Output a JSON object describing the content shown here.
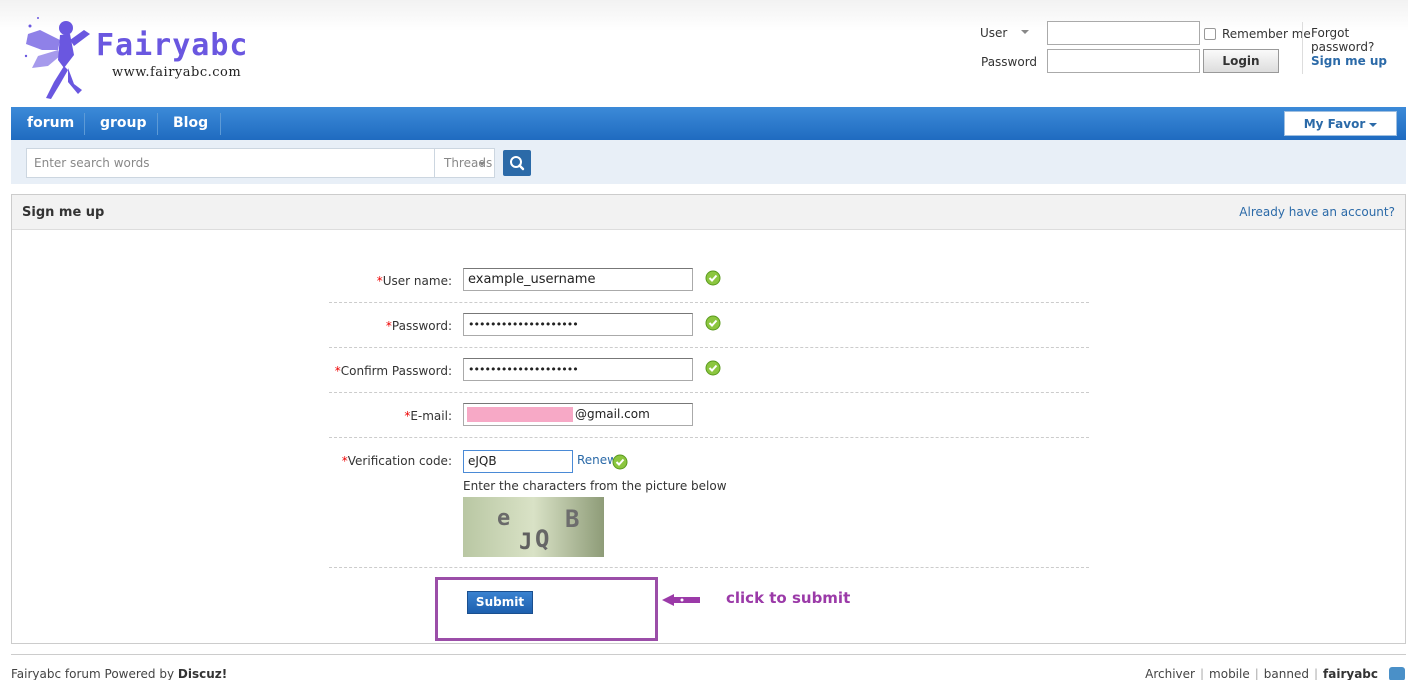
{
  "header": {
    "logo_title": "Fairyabc",
    "logo_url": "www.fairyabc.com",
    "user_label": "User",
    "password_label": "Password",
    "remember_label": "Remember me",
    "login_label": "Login",
    "forgot_label": "Forgot password?",
    "signup_label": "Sign me up"
  },
  "nav": {
    "items": [
      {
        "label": "forum"
      },
      {
        "label": "group"
      },
      {
        "label": "Blog"
      }
    ],
    "favor_label": "My Favor"
  },
  "search": {
    "placeholder": "Enter search words",
    "type_label": "Threads"
  },
  "panel": {
    "title": "Sign me up",
    "have_account": "Already have an account?"
  },
  "form": {
    "required_mark": "*",
    "username_label": "User name:",
    "username_value": "example_username",
    "password_label": "Password:",
    "password_value": "••••••••••••••••••••",
    "confirm_label": "Confirm Password:",
    "confirm_value": "••••••••••••••••••••",
    "email_label": "E-mail:",
    "email_value": "@gmail.com",
    "verify_label": "Verification code:",
    "verify_value": "eJQB",
    "renew_label": "Renew",
    "verify_hint": "Enter the characters from the picture below",
    "captcha_text": "eJQB",
    "submit_label": "Submit",
    "annotation": "click to submit",
    "status_icon": "check-circle-icon",
    "annotation_color": "#9b3aa8"
  },
  "footer": {
    "left_text": "Fairyabc forum Powered by ",
    "left_brand": "Discuz!",
    "links": [
      "Archiver",
      "mobile",
      "banned"
    ],
    "brand": "fairyabc"
  }
}
